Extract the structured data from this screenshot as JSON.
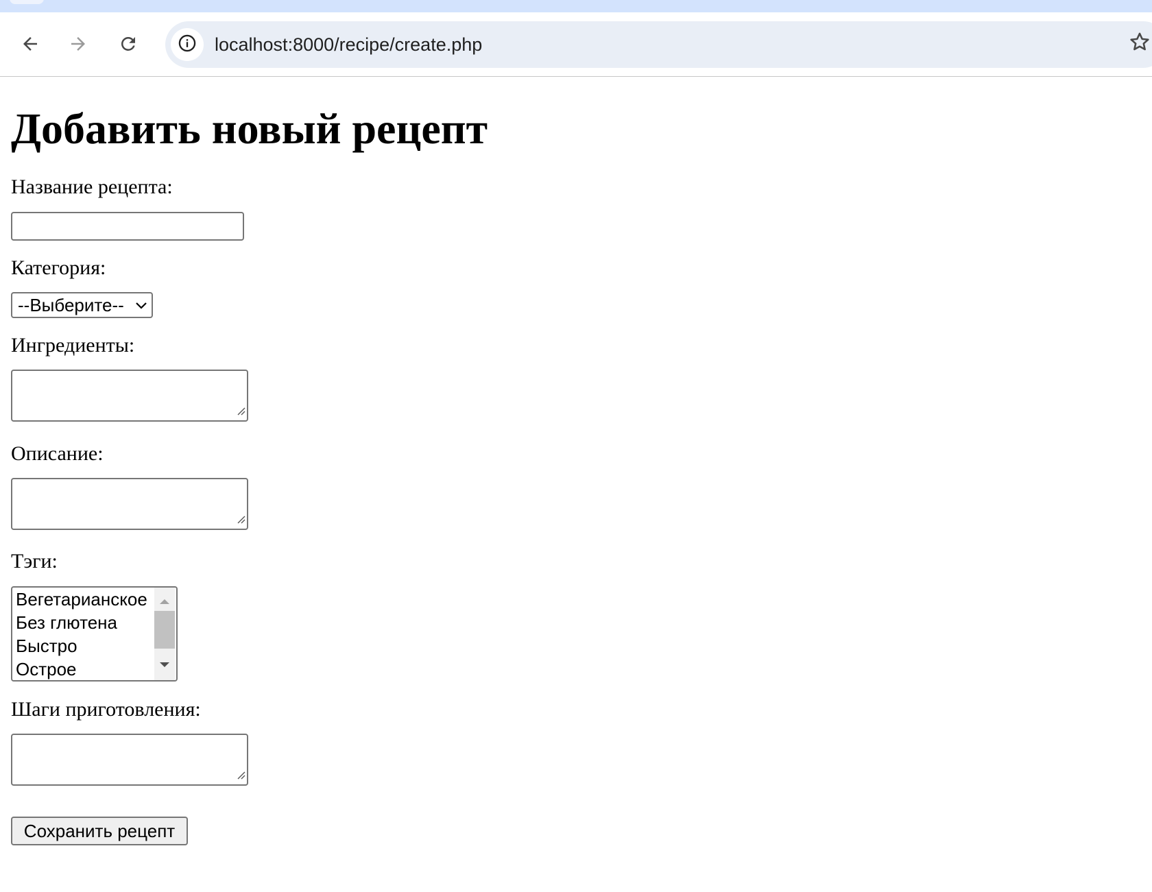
{
  "browser": {
    "url": "localhost:8000/recipe/create.php",
    "icons": {
      "back": "arrow-left-icon",
      "forward": "arrow-right-icon",
      "reload": "reload-icon",
      "site_info": "info-icon",
      "bookmark": "star-icon"
    }
  },
  "page": {
    "title": "Добавить новый рецепт",
    "form": {
      "name_label": "Название рецепта:",
      "name_value": "",
      "category_label": "Категория:",
      "category_selected": "--Выберите--",
      "ingredients_label": "Ингредиенты:",
      "ingredients_value": "",
      "description_label": "Описание:",
      "description_value": "",
      "tags_label": "Тэги:",
      "tags_options": [
        "Вегетарианское",
        "Без глютена",
        "Быстро",
        "Острое"
      ],
      "steps_label": "Шаги приготовления:",
      "steps_value": "",
      "submit_label": "Сохранить рецепт"
    }
  }
}
